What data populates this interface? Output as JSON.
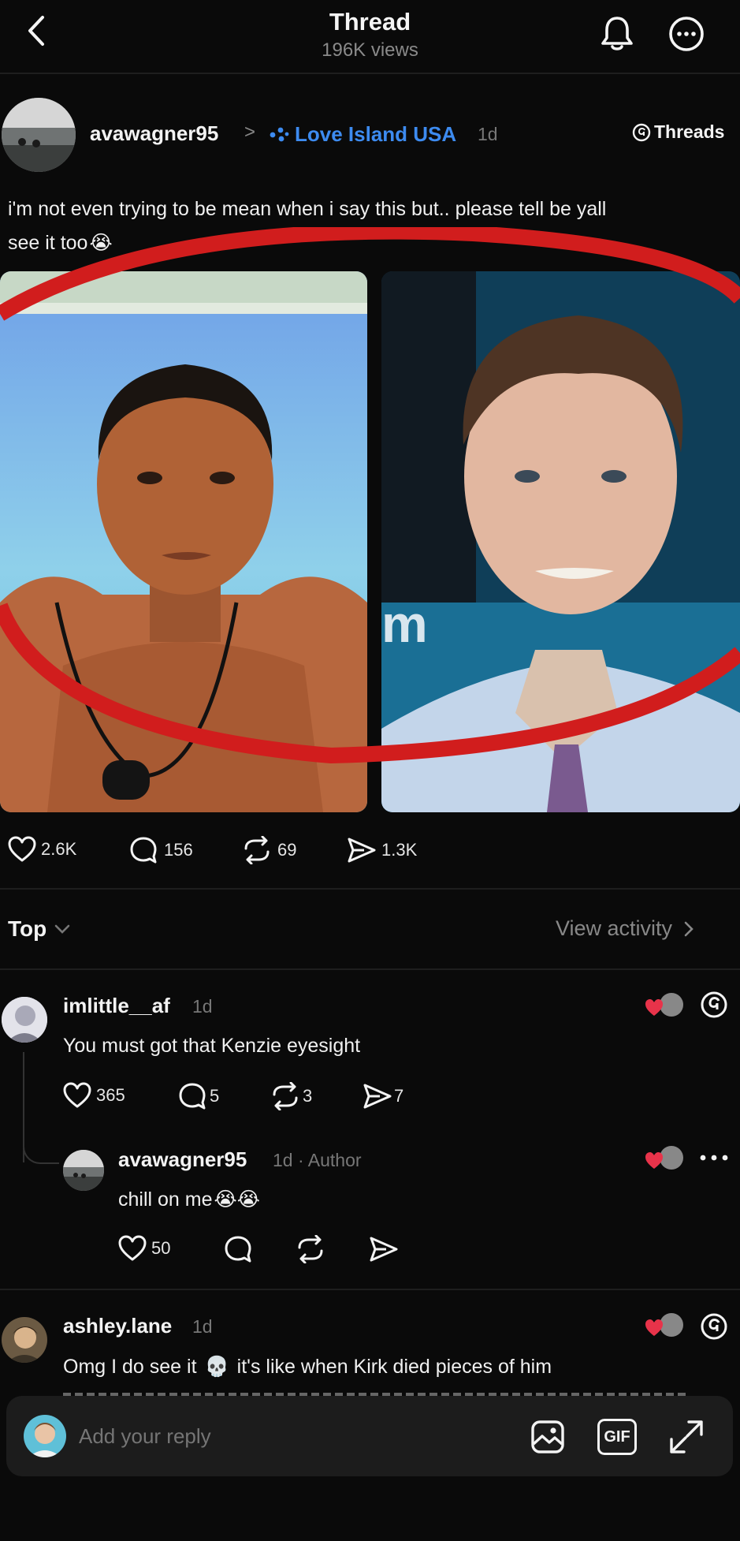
{
  "header": {
    "title": "Thread",
    "views": "196K views"
  },
  "post": {
    "username": "avawagner95",
    "separator": ">",
    "community": "Love Island USA",
    "time": "1d",
    "source": "Threads",
    "text_line1": "i'm not even trying to be mean when i say this but.. please tell be yall",
    "text_line2": "see it too",
    "emoji": "😭",
    "likes": "2.6K",
    "replies": "156",
    "reposts": "69",
    "shares": "1.3K"
  },
  "sort": {
    "label": "Top",
    "view_activity": "View activity"
  },
  "comments": [
    {
      "username": "imlittle__af",
      "time": "1d",
      "text": "You must got that Kenzie eyesight",
      "likes": "365",
      "replies": "5",
      "reposts": "3",
      "shares": "7"
    },
    {
      "username": "avawagner95",
      "time": "1d",
      "author_tag": "· Author",
      "text": "chill on me",
      "emoji": "😭😭",
      "likes": "50"
    },
    {
      "username": "ashley.lane",
      "time": "1d",
      "text_part1": "Omg I do see it",
      "emoji": "💀",
      "text_part2": "it's like when Kirk died pieces of him"
    }
  ],
  "reply_bar": {
    "placeholder": "Add your reply",
    "gif_label": "GIF"
  },
  "colors": {
    "background": "#0a0a0a",
    "link_blue": "#3d8bf0",
    "heart_red": "#e8334a",
    "circle_red": "#d11d1d"
  }
}
